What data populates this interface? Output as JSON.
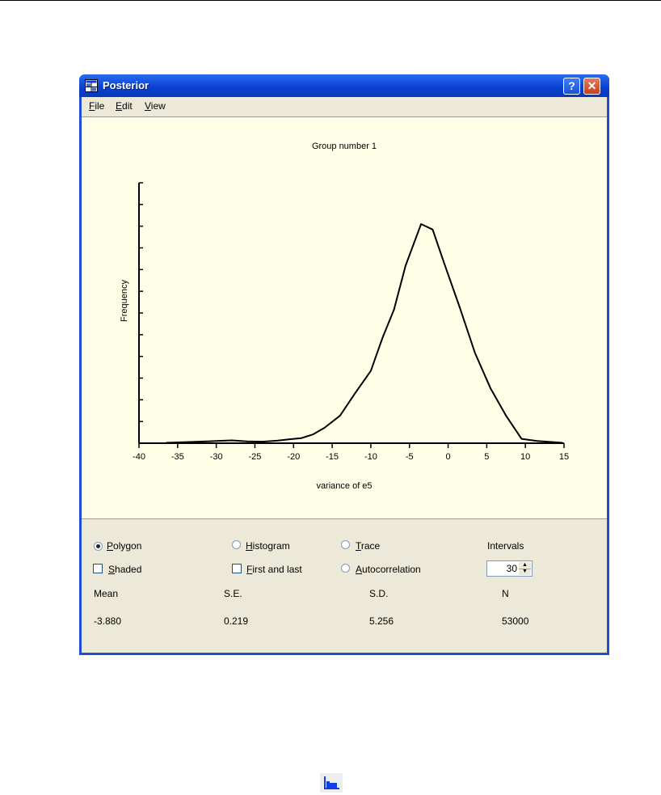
{
  "window": {
    "title": "Posterior",
    "help_glyph": "?",
    "close_glyph": "✕"
  },
  "menu": {
    "items": [
      {
        "label": "File",
        "key": "F",
        "rest": "ile"
      },
      {
        "label": "Edit",
        "key": "E",
        "rest": "dit"
      },
      {
        "label": "View",
        "key": "V",
        "rest": "iew"
      }
    ]
  },
  "chart_data": {
    "type": "line",
    "title": "Group number 1",
    "xlabel": "variance of e5",
    "ylabel": "Frequency",
    "xlim": [
      -40,
      15
    ],
    "xticks": [
      -40,
      -35,
      -30,
      -25,
      -20,
      -15,
      -10,
      -5,
      0,
      5,
      10,
      15
    ],
    "y_minor_ticks": 12,
    "series": [
      {
        "x": [
          -36.5,
          -33,
          -30,
          -28,
          -26,
          -24,
          -22,
          -20.5,
          -19,
          -17.5,
          -16,
          -14,
          -12,
          -10,
          -8.5,
          -7,
          -5.5,
          -3.5,
          -2,
          -0.5,
          1.5,
          3.5,
          5.5,
          7.5,
          9.5,
          11.5,
          13.5,
          14.8
        ],
        "y": [
          0.2,
          0.6,
          1.0,
          1.3,
          0.8,
          0.7,
          1.2,
          1.8,
          2.3,
          4.0,
          7.0,
          12.5,
          23,
          33,
          48,
          61,
          81,
          100,
          97.5,
          82,
          62,
          41,
          25,
          12.5,
          2,
          1,
          0.5,
          0.2
        ]
      }
    ],
    "grid": false,
    "legend": "none"
  },
  "controls": {
    "polygon": {
      "label": "Polygon",
      "key": "P",
      "rest": "olygon",
      "checked": true
    },
    "histogram": {
      "label": "Histogram",
      "key": "H",
      "rest": "istogram",
      "checked": false
    },
    "trace": {
      "label": "Trace",
      "key": "T",
      "rest": "race",
      "checked": false
    },
    "shaded": {
      "label": "Shaded",
      "key": "S",
      "rest": "haded",
      "checked": false
    },
    "first_last": {
      "label": "First and last",
      "key": "F",
      "rest": "irst and last",
      "checked": false
    },
    "autocorrelation": {
      "label": "Autocorrelation",
      "key": "A",
      "rest": "utocorrelation",
      "checked": false
    },
    "intervals_label": "Intervals",
    "intervals_value": "30"
  },
  "stats": {
    "headers": [
      "Mean",
      "S.E.",
      "S.D.",
      "N"
    ],
    "values": [
      "-3.880",
      "0.219",
      "5.256",
      "53000"
    ]
  },
  "bottom_icon": "histogram-icon"
}
